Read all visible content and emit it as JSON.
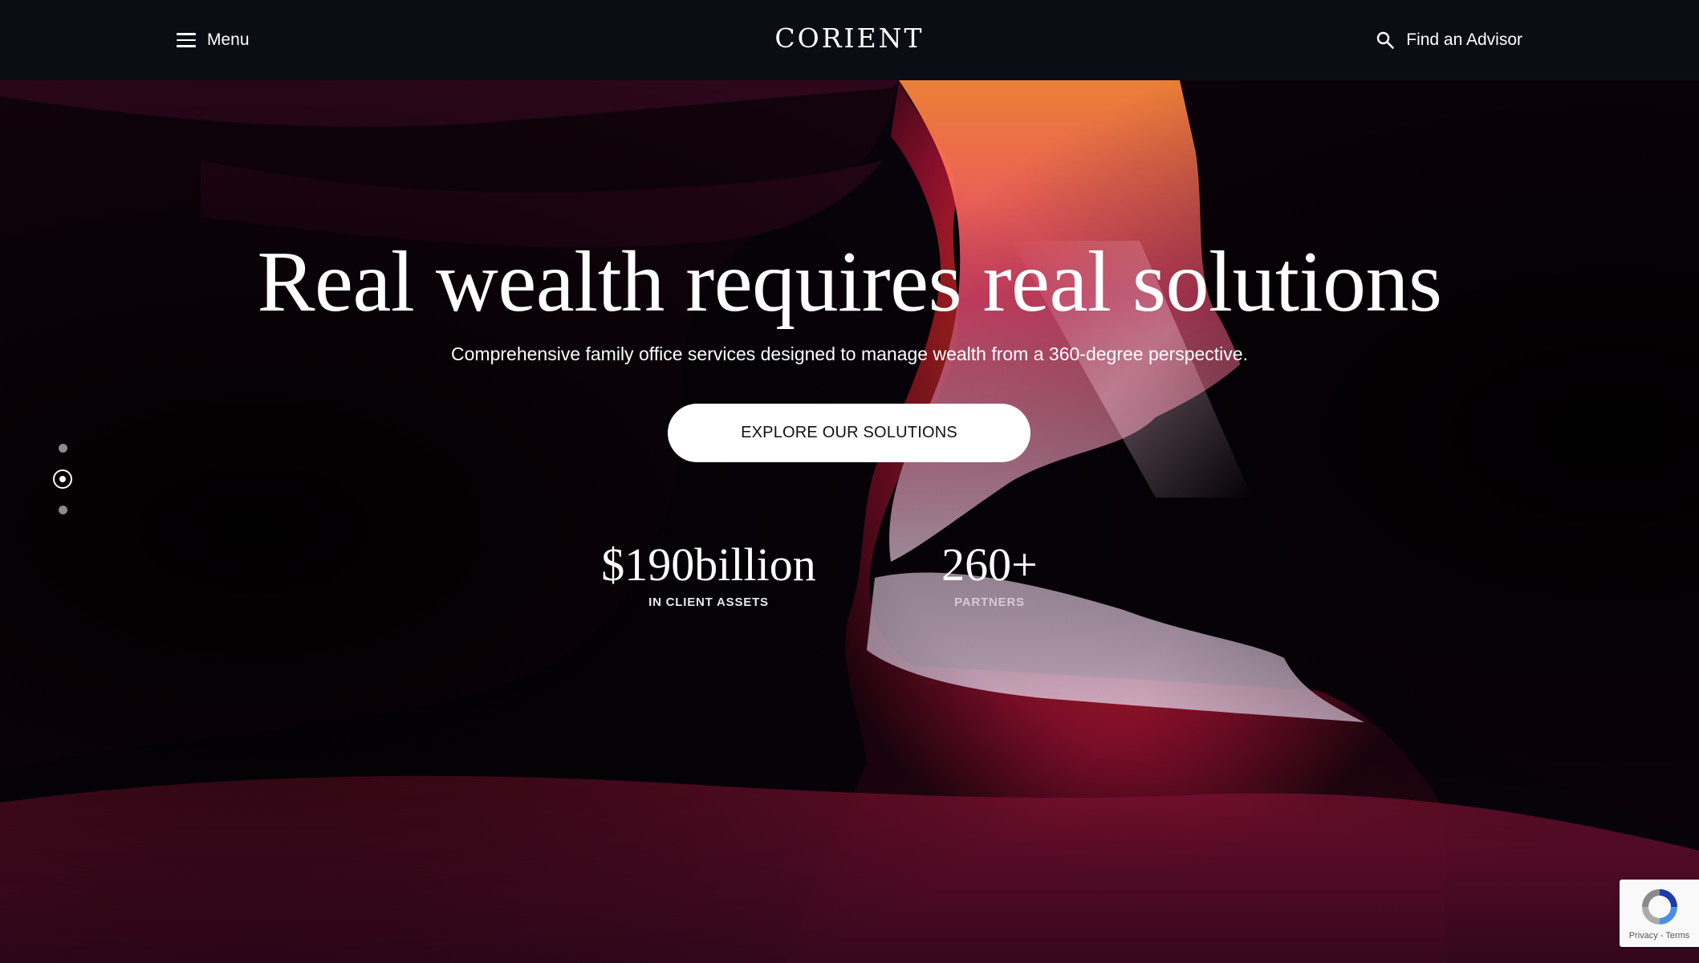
{
  "header": {
    "menu_label": "Menu",
    "logo_text": "CORIENT",
    "advisor_label": "Find an Advisor"
  },
  "hero": {
    "title": "Real wealth requires real solutions",
    "subtitle": "Comprehensive family office services designed to manage wealth from a 360-degree perspective.",
    "cta_label": "EXPLORE OUR SOLUTIONS"
  },
  "stats": [
    {
      "value": "$190billion",
      "label": "IN CLIENT ASSETS"
    },
    {
      "value": "260+",
      "label": "PARTNERS"
    }
  ],
  "slider": {
    "slide_count": 3,
    "active_index": 2
  },
  "recaptcha": {
    "privacy_label": "Privacy",
    "separator": " - ",
    "terms_label": "Terms"
  },
  "colors": {
    "header_bg": "#0a1016",
    "cta_bg": "#ffffff",
    "canyon_orange": "#e8501c",
    "canyon_magenta": "#c0245a"
  }
}
